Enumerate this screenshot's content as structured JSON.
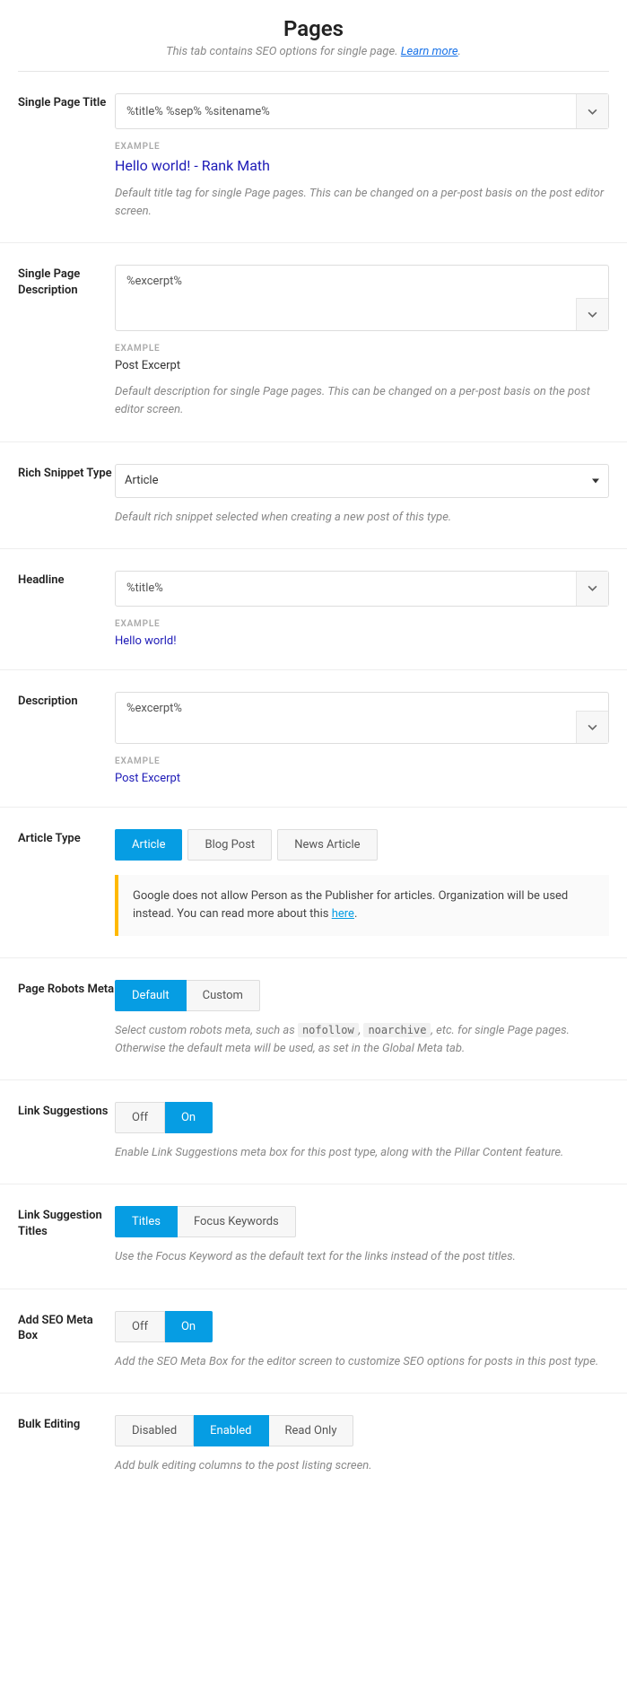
{
  "header": {
    "title": "Pages",
    "subtitle_prefix": "This tab contains SEO options for single page. ",
    "learn_more": "Learn more"
  },
  "single_page_title": {
    "label": "Single Page Title",
    "value": "%title% %sep% %sitename%",
    "example_label": "EXAMPLE",
    "example_value": "Hello world! - Rank Math",
    "help": "Default title tag for single Page pages. This can be changed on a per-post basis on the post editor screen."
  },
  "single_page_desc": {
    "label": "Single Page Description",
    "value": "%excerpt%",
    "example_label": "EXAMPLE",
    "example_value": "Post Excerpt",
    "help": "Default description for single Page pages. This can be changed on a per-post basis on the post editor screen."
  },
  "rich_snippet": {
    "label": "Rich Snippet Type",
    "value": "Article",
    "help": "Default rich snippet selected when creating a new post of this type."
  },
  "headline": {
    "label": "Headline",
    "value": "%title%",
    "example_label": "EXAMPLE",
    "example_value": "Hello world!"
  },
  "description": {
    "label": "Description",
    "value": "%excerpt%",
    "example_label": "EXAMPLE",
    "example_value": "Post Excerpt"
  },
  "article_type": {
    "label": "Article Type",
    "options": [
      "Article",
      "Blog Post",
      "News Article"
    ],
    "active": 0,
    "notice_prefix": "Google does not allow Person as the Publisher for articles. Organization will be used instead. You can read more about this ",
    "notice_link": "here"
  },
  "robots_meta": {
    "label": "Page Robots Meta",
    "options": [
      "Default",
      "Custom"
    ],
    "active": 0,
    "help_prefix": "Select custom robots meta, such as ",
    "help_code1": "nofollow",
    "help_mid": ", ",
    "help_code2": "noarchive",
    "help_suffix": ", etc. for single Page pages. Otherwise the default meta will be used, as set in the Global Meta tab."
  },
  "link_suggestions": {
    "label": "Link Suggestions",
    "options": [
      "Off",
      "On"
    ],
    "active": 1,
    "help": "Enable Link Suggestions meta box for this post type, along with the Pillar Content feature."
  },
  "link_suggestion_titles": {
    "label": "Link Suggestion Titles",
    "options": [
      "Titles",
      "Focus Keywords"
    ],
    "active": 0,
    "help": "Use the Focus Keyword as the default text for the links instead of the post titles."
  },
  "add_seo_meta_box": {
    "label": "Add SEO Meta Box",
    "options": [
      "Off",
      "On"
    ],
    "active": 1,
    "help": "Add the SEO Meta Box for the editor screen to customize SEO options for posts in this post type."
  },
  "bulk_editing": {
    "label": "Bulk Editing",
    "options": [
      "Disabled",
      "Enabled",
      "Read Only"
    ],
    "active": 1,
    "help": "Add bulk editing columns to the post listing screen."
  }
}
